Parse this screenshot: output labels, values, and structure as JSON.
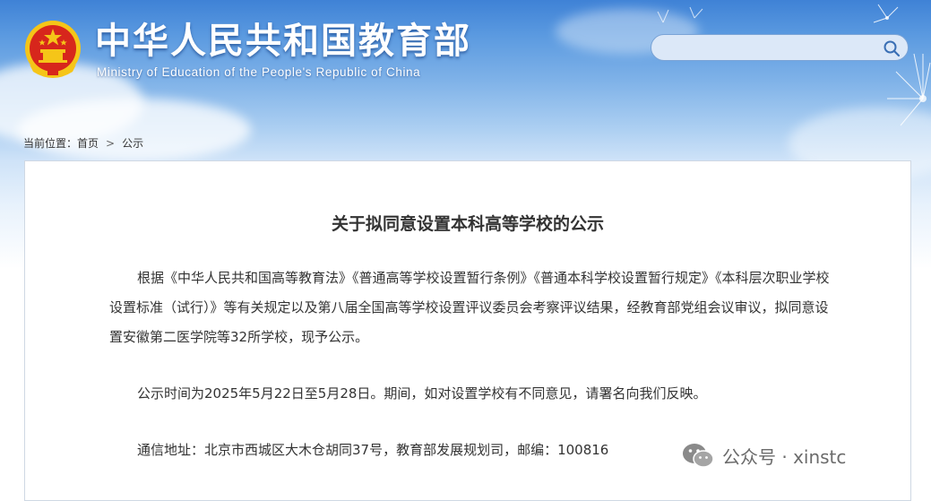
{
  "header": {
    "title_cn": "中华人民共和国教育部",
    "title_en": "Ministry of Education of the People's Republic of China",
    "search": {
      "value": "",
      "placeholder": ""
    }
  },
  "breadcrumb": {
    "prefix": "当前位置：",
    "home": "首页",
    "separator": ">",
    "current": "公示"
  },
  "article": {
    "title": "关于拟同意设置本科高等学校的公示",
    "paragraphs": [
      "根据《中华人民共和国高等教育法》《普通高等学校设置暂行条例》《普通本科学校设置暂行规定》《本科层次职业学校设置标准（试行）》等有关规定以及第八届全国高等学校设置评议委员会考察评议结果，经教育部党组会议审议，拟同意设置安徽第二医学院等32所学校，现予公示。",
      "公示时间为2025年5月22日至5月28日。期间，如对设置学校有不同意见，请署名向我们反映。",
      "通信地址：北京市西城区大木仓胡同37号，教育部发展规划司，邮编：100816"
    ]
  },
  "watermark": {
    "text": "公众号 · xinstc",
    "icon": "wechat-icon"
  },
  "colors": {
    "sky_top": "#3f82d6",
    "text": "#333333",
    "emblem_red": "#d7261c",
    "emblem_gold": "#f5c518"
  }
}
